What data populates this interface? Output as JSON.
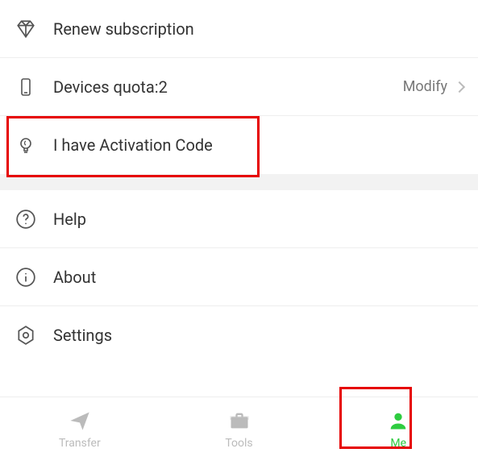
{
  "menu": {
    "group1": [
      {
        "icon": "diamond-icon",
        "label": "Renew subscription"
      },
      {
        "icon": "device-icon",
        "label": "Devices quota:2",
        "right_label": "Modify",
        "has_chevron": true
      },
      {
        "icon": "bulb-icon",
        "label": "I have Activation Code"
      }
    ],
    "group2": [
      {
        "icon": "help-icon",
        "label": "Help"
      },
      {
        "icon": "info-icon",
        "label": "About"
      },
      {
        "icon": "settings-icon",
        "label": "Settings"
      }
    ]
  },
  "tabs": [
    {
      "icon": "send-icon",
      "label": "Transfer",
      "active": false
    },
    {
      "icon": "briefcase-icon",
      "label": "Tools",
      "active": false
    },
    {
      "icon": "person-icon",
      "label": "Me",
      "active": true
    }
  ],
  "highlights": {
    "activation_code_row": true,
    "me_tab": true
  }
}
